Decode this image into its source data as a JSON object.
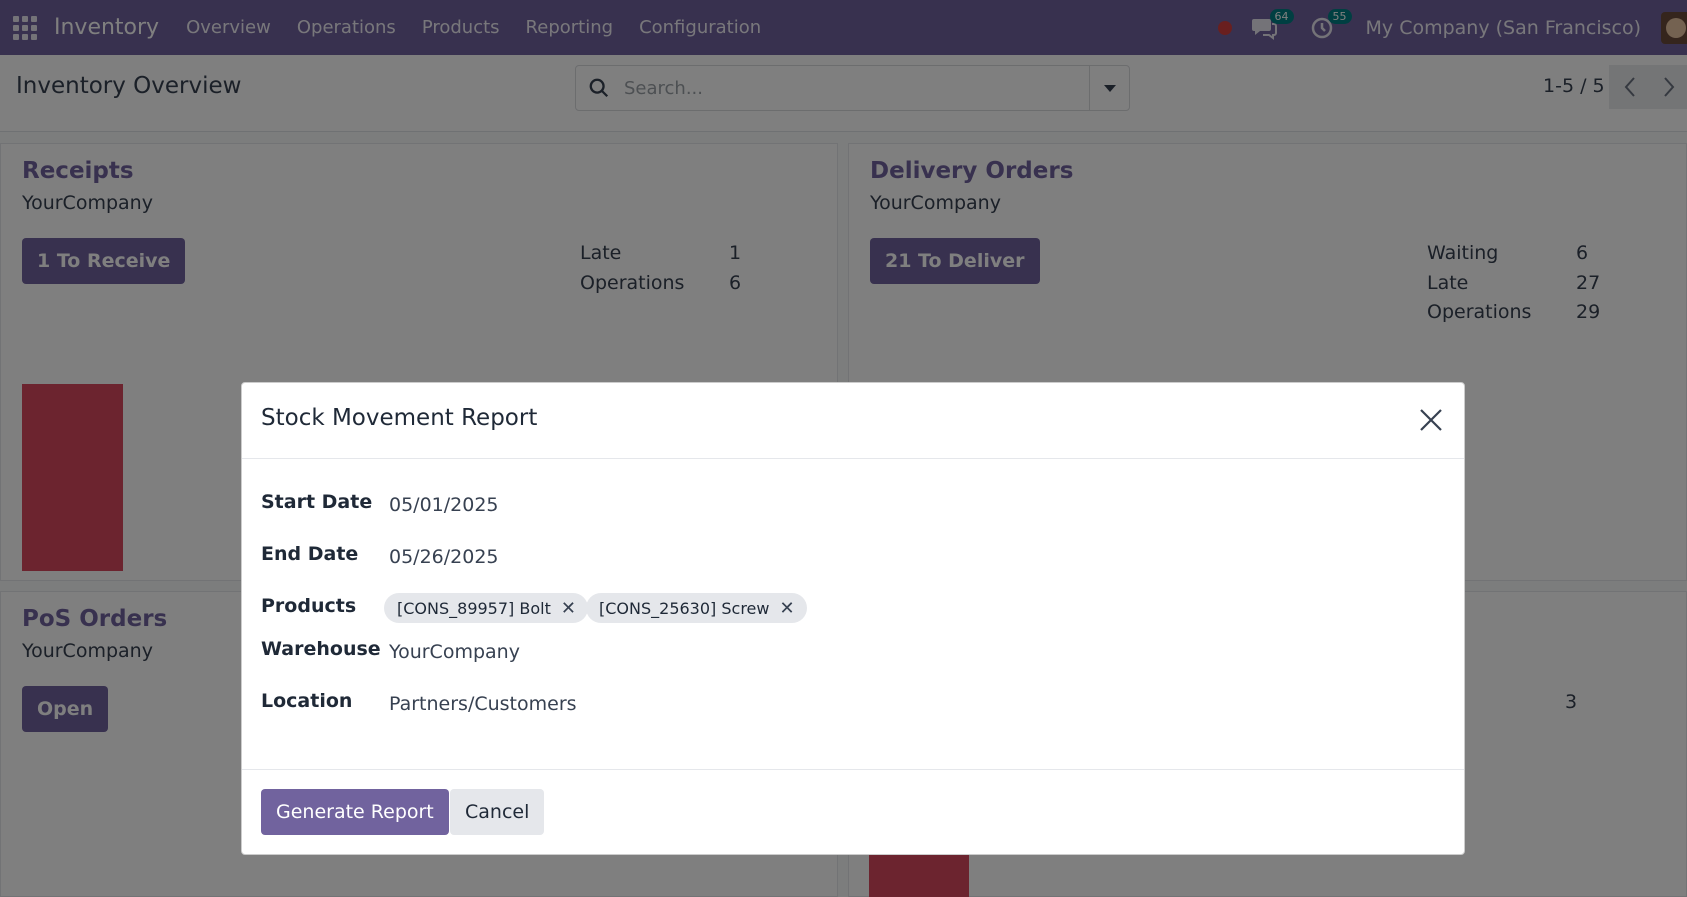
{
  "navbar": {
    "brand": "Inventory",
    "menu": [
      "Overview",
      "Operations",
      "Products",
      "Reporting",
      "Configuration"
    ],
    "messages_count": "64",
    "activities_count": "55",
    "company": "My Company (San Francisco)"
  },
  "control_panel": {
    "title": "Inventory Overview",
    "search_placeholder": "Search...",
    "pager": "1-5 / 5"
  },
  "cards": {
    "receipts": {
      "title": "Receipts",
      "company": "YourCompany",
      "button": "1 To Receive",
      "stats": [
        {
          "label": "Late",
          "value": "1"
        },
        {
          "label": "Operations",
          "value": "6"
        }
      ]
    },
    "delivery": {
      "title": "Delivery Orders",
      "company": "YourCompany",
      "button": "21 To Deliver",
      "stats": [
        {
          "label": "Waiting",
          "value": "6"
        },
        {
          "label": "Late",
          "value": "27"
        },
        {
          "label": "Operations",
          "value": "29"
        }
      ]
    },
    "pos": {
      "title": "PoS Orders",
      "company": "YourCompany",
      "button": "Open"
    },
    "hidden_card": {
      "stat_value": "3"
    }
  },
  "modal": {
    "title": "Stock Movement Report",
    "fields": {
      "start_date": {
        "label": "Start Date",
        "value": "05/01/2025"
      },
      "end_date": {
        "label": "End Date",
        "value": "05/26/2025"
      },
      "products": {
        "label": "Products",
        "tags": [
          "[CONS_89957] Bolt",
          "[CONS_25630] Screw"
        ]
      },
      "warehouse": {
        "label": "Warehouse",
        "value": "YourCompany"
      },
      "location": {
        "label": "Location",
        "value": "Partners/Customers"
      }
    },
    "generate_button": "Generate Report",
    "cancel_button": "Cancel"
  },
  "colors": {
    "brand": "#71639e",
    "bar": "#d9485f",
    "badge": "#017e84"
  }
}
